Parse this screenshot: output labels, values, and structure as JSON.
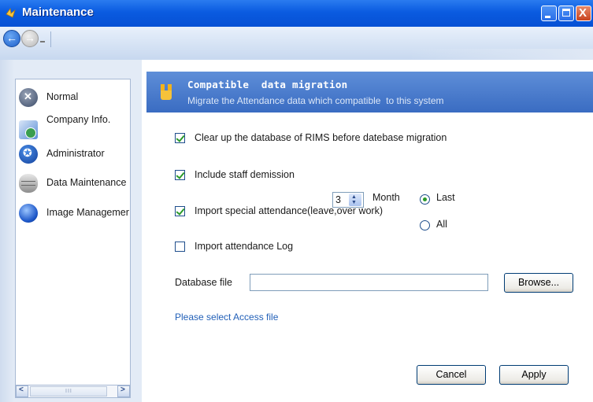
{
  "window": {
    "title": "Maintenance",
    "close_glyph": "X"
  },
  "nav": {
    "back_icon": "back-arrow-icon",
    "forward_icon": "forward-arrow-icon"
  },
  "sidebar": {
    "items": [
      {
        "label": "Normal",
        "icon": "normal-icon"
      },
      {
        "label": "Company Info.",
        "icon": "company-info-icon"
      },
      {
        "label": "Administrator",
        "icon": "administrator-icon"
      },
      {
        "label": "Data Maintenance",
        "icon": "database-icon"
      },
      {
        "label": "Image Managemer",
        "icon": "image-management-icon"
      }
    ],
    "scroll_grip": "III"
  },
  "header": {
    "title": "Compatible  data migration",
    "subtitle": "Migrate the Attendance data which compatible  to this system"
  },
  "options": {
    "clear_db": {
      "label": "Clear up the database of RIMS before datebase migration",
      "checked": true
    },
    "include_staff": {
      "label": "Include staff demission",
      "checked": true
    },
    "import_special": {
      "label": "Import special attendance(leave,over work)",
      "checked": true
    },
    "import_log": {
      "label": "Import attendance Log",
      "checked": false
    }
  },
  "range": {
    "last_label": "Last",
    "all_label": "All",
    "selected": "Last",
    "months_value": "3",
    "unit_label": "Month"
  },
  "database": {
    "label": "Database file",
    "value": "",
    "browse_label": "Browse..."
  },
  "hint": "Please select Access file",
  "actions": {
    "cancel_label": "Cancel",
    "apply_label": "Apply"
  },
  "colors": {
    "titlebar": "#0a5be0",
    "header": "#4a7cd0",
    "check": "#2a9a2a",
    "link": "#2260b8"
  }
}
